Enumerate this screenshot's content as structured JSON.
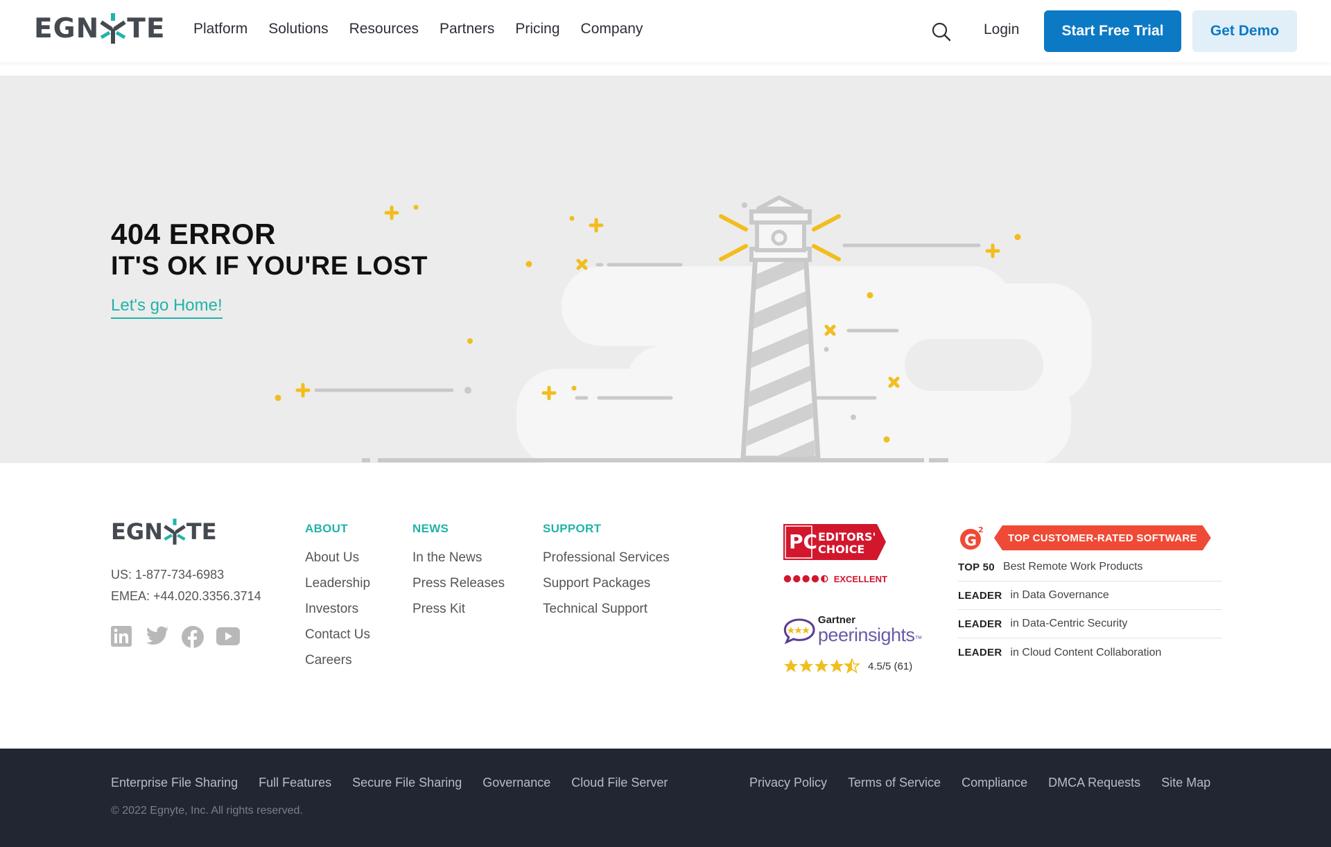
{
  "header": {
    "logo_text_left": "EGN",
    "logo_text_right": "TE",
    "nav": [
      "Platform",
      "Solutions",
      "Resources",
      "Partners",
      "Pricing",
      "Company"
    ],
    "login": "Login",
    "trial_button": "Start Free Trial",
    "demo_button": "Get Demo",
    "search_icon": "search-icon"
  },
  "hero": {
    "title": "404 ERROR",
    "subtitle": "IT'S OK IF YOU'RE LOST",
    "home_link": "Let's go Home!",
    "illustration": "lighthouse-illustration"
  },
  "footer": {
    "logo_text_left": "EGN",
    "logo_text_right": "TE",
    "phone_us": "US: 1-877-734-6983",
    "phone_emea": "EMEA: +44.020.3356.3714",
    "social": [
      "linkedin-icon",
      "twitter-icon",
      "facebook-icon",
      "youtube-icon"
    ],
    "about": {
      "heading": "ABOUT",
      "links": [
        "About Us",
        "Leadership",
        "Investors",
        "Contact Us",
        "Careers"
      ]
    },
    "news": {
      "heading": "NEWS",
      "links": [
        "In the News",
        "Press Releases",
        "Press Kit"
      ]
    },
    "support": {
      "heading": "SUPPORT",
      "links": [
        "Professional Services",
        "Support Packages",
        "Technical Support"
      ]
    },
    "pc_badge": {
      "line1": "EDITORS'",
      "line2": "CHOICE",
      "pc": "PC",
      "rating_label": "EXCELLENT",
      "rating": 4.5
    },
    "gartner": {
      "brand": "Gartner",
      "product": "peerinsights",
      "tm": "™",
      "rating_text": "4.5/5 (61)",
      "stars": 4.5
    },
    "g2": {
      "logo": "G",
      "sup": "2",
      "banner": "TOP CUSTOMER-RATED SOFTWARE",
      "rows": [
        {
          "tag": "TOP 50",
          "text": "Best Remote Work Products"
        },
        {
          "tag": "LEADER",
          "text": "in Data Governance"
        },
        {
          "tag": "LEADER",
          "text": "in Data-Centric Security"
        },
        {
          "tag": "LEADER",
          "text": "in Cloud Content Collaboration"
        }
      ]
    }
  },
  "bottom": {
    "left_links": [
      "Enterprise File Sharing",
      "Full Features",
      "Secure File Sharing",
      "Governance",
      "Cloud File Server"
    ],
    "right_links": [
      "Privacy Policy",
      "Terms of Service",
      "Compliance",
      "DMCA Requests",
      "Site Map"
    ],
    "copyright": "© 2022 Egnyte, Inc. All rights reserved."
  },
  "colors": {
    "primary": "#0c79c4",
    "teal": "#21b3a8",
    "hero_bg": "#ececec",
    "accent_yellow": "#f2bd1d",
    "g2_red": "#ef4a35",
    "pc_red": "#d2172d",
    "bottom_bg": "#222632"
  }
}
